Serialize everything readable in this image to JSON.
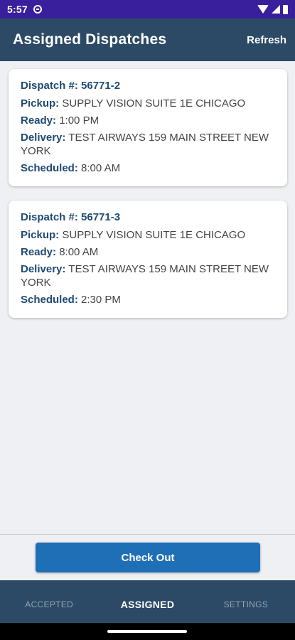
{
  "status_bar": {
    "time": "5:57"
  },
  "app_bar": {
    "title": "Assigned Dispatches",
    "refresh_label": "Refresh"
  },
  "labels": {
    "dispatch": "Dispatch #:",
    "pickup": "Pickup:",
    "ready": "Ready:",
    "delivery": "Delivery:",
    "scheduled": "Scheduled:"
  },
  "dispatches": [
    {
      "number": "56771-2",
      "pickup": "SUPPLY VISION SUITE 1E CHICAGO",
      "ready": "1:00 PM",
      "delivery": "TEST AIRWAYS 159 MAIN STREET NEW YORK",
      "scheduled": "8:00 AM"
    },
    {
      "number": "56771-3",
      "pickup": "SUPPLY VISION SUITE 1E CHICAGO",
      "ready": "8:00 AM",
      "delivery": "TEST AIRWAYS 159 MAIN STREET NEW YORK",
      "scheduled": "2:30 PM"
    }
  ],
  "checkout_label": "Check Out",
  "tabs": [
    {
      "label": "ACCEPTED"
    },
    {
      "label": "ASSIGNED"
    },
    {
      "label": "SETTINGS"
    }
  ],
  "active_tab": "ASSIGNED",
  "colors": {
    "status_bar": "#3a1f9c",
    "header": "#2c4a66",
    "label": "#1f4a73",
    "button": "#1f6fb6"
  }
}
